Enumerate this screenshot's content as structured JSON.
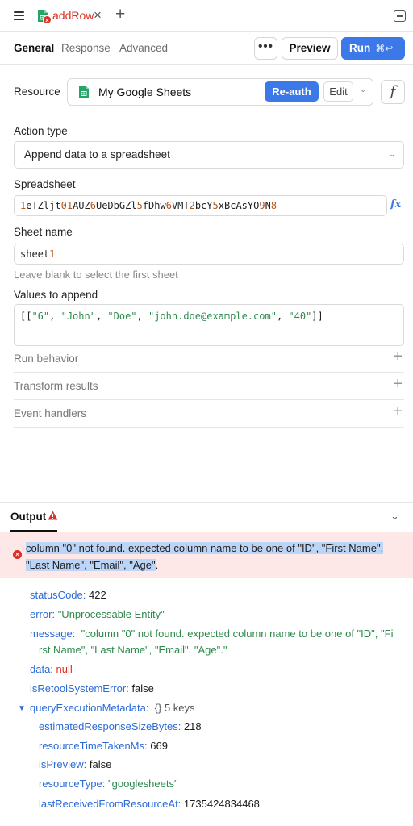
{
  "tab": {
    "title": "addRow",
    "close_glyph": "×",
    "add_glyph": "+",
    "icon": "google-sheets-icon",
    "status": "error"
  },
  "nav": {
    "tabs": [
      "General",
      "Response",
      "Advanced"
    ],
    "active": "General",
    "more_label": "•••",
    "preview_label": "Preview",
    "run_label": "Run",
    "run_shortcut": "⌘↩"
  },
  "resource": {
    "label": "Resource",
    "name": "My Google Sheets",
    "reauth_label": "Re-auth",
    "edit_label": "Edit",
    "fx_label": "f"
  },
  "action_type": {
    "label": "Action type",
    "value": "Append data to a spreadsheet"
  },
  "spreadsheet": {
    "label": "Spreadsheet",
    "value_parts": [
      {
        "t": "1",
        "c": "num"
      },
      {
        "t": "eTZljt",
        "c": ""
      },
      {
        "t": "0",
        "c": "num"
      },
      {
        "t": "1",
        "c": "num"
      },
      {
        "t": "AUZ",
        "c": ""
      },
      {
        "t": "6",
        "c": "num"
      },
      {
        "t": "UeDbGZl",
        "c": ""
      },
      {
        "t": "5",
        "c": "num"
      },
      {
        "t": "fDhw",
        "c": ""
      },
      {
        "t": "6",
        "c": "num"
      },
      {
        "t": "VMT",
        "c": ""
      },
      {
        "t": "2",
        "c": "num"
      },
      {
        "t": "bcY",
        "c": ""
      },
      {
        "t": "5",
        "c": "num"
      },
      {
        "t": "xBcAsYO",
        "c": ""
      },
      {
        "t": "9",
        "c": "num"
      },
      {
        "t": "N",
        "c": ""
      },
      {
        "t": "8",
        "c": "num"
      }
    ],
    "fx_label": "fx"
  },
  "sheet_name": {
    "label": "Sheet name",
    "value_text": "sheet",
    "value_num": "1",
    "helper": "Leave blank to select the first sheet"
  },
  "values": {
    "label": "Values to append",
    "parts": [
      {
        "t": "[[",
        "c": ""
      },
      {
        "t": "\"6\"",
        "c": "str"
      },
      {
        "t": ", ",
        "c": ""
      },
      {
        "t": "\"John\"",
        "c": "str"
      },
      {
        "t": ", ",
        "c": ""
      },
      {
        "t": "\"Doe\"",
        "c": "str"
      },
      {
        "t": ", ",
        "c": ""
      },
      {
        "t": "\"john.doe@example.com\"",
        "c": "str"
      },
      {
        "t": ", ",
        "c": ""
      },
      {
        "t": "\"40\"",
        "c": "str"
      },
      {
        "t": "]]",
        "c": ""
      }
    ]
  },
  "sections": [
    "Run behavior",
    "Transform results",
    "Event handlers"
  ],
  "output": {
    "label": "Output",
    "error_message_line1": "column \"0\" not found. expected column name to be one of \"ID\", \"First Name\",",
    "error_message_line2": "\"Last Name\", \"Email\", \"Age\"",
    "error_message_end": ".",
    "fields": {
      "statusCode": {
        "key": "statusCode:",
        "value": "422"
      },
      "error": {
        "key": "error:",
        "value": "\"Unprocessable Entity\""
      },
      "message": {
        "key": "message:",
        "value_line1": "\"column \"0\" not found. expected column name to be one of \"ID\", \"Fi",
        "value_line2": "rst Name\", \"Last Name\", \"Email\", \"Age\".\""
      },
      "data": {
        "key": "data:",
        "value": "null"
      },
      "isRetoolSystemError": {
        "key": "isRetoolSystemError:",
        "value": "false"
      },
      "queryExecutionMetadata": {
        "key": "queryExecutionMetadata:",
        "value": "{}  5 keys"
      }
    },
    "metadata": {
      "estimatedResponseSizeBytes": {
        "key": "estimatedResponseSizeBytes:",
        "value": "218"
      },
      "resourceTimeTakenMs": {
        "key": "resourceTimeTakenMs:",
        "value": "669"
      },
      "isPreview": {
        "key": "isPreview:",
        "value": "false"
      },
      "resourceType": {
        "key": "resourceType:",
        "value": "\"googlesheets\""
      },
      "lastReceivedFromResourceAt": {
        "key": "lastReceivedFromResourceAt:",
        "value": "1735424834468"
      }
    }
  },
  "colors": {
    "accent": "#3c78e8",
    "error": "#d93025",
    "error_bg": "#fde8e7",
    "string": "#2d8a4c",
    "number": "#b5541c",
    "key": "#2b6bd6",
    "selection": "#bcd4f5"
  }
}
